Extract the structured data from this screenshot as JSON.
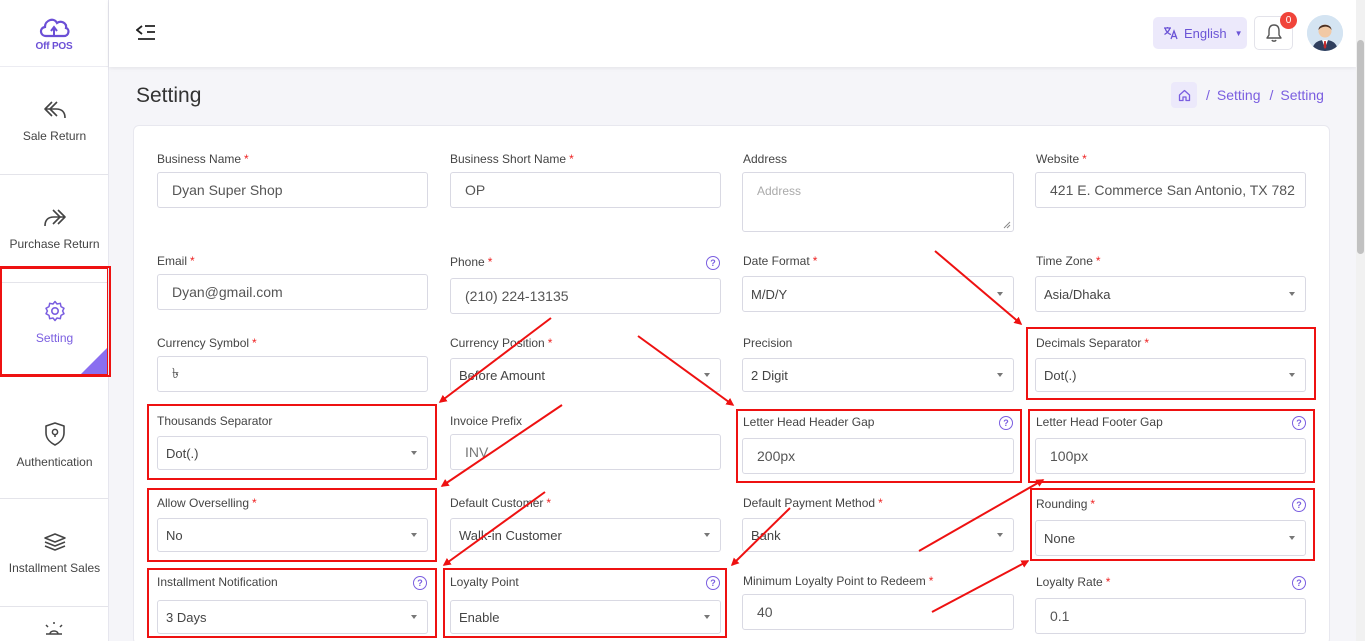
{
  "app": {
    "logo_text": "Off POS"
  },
  "sidebar": {
    "items": [
      {
        "label": "Sale Return",
        "icon": "sale-return-icon"
      },
      {
        "label": "Purchase Return",
        "icon": "purchase-return-icon"
      },
      {
        "label": "Setting",
        "icon": "gear-icon",
        "active": true
      },
      {
        "label": "Authentication",
        "icon": "shield-icon"
      },
      {
        "label": "Installment Sales",
        "icon": "stack-icon"
      }
    ]
  },
  "header": {
    "language": "English",
    "notification_count": "0"
  },
  "page": {
    "title": "Setting",
    "breadcrumb": [
      "Setting",
      "Setting"
    ]
  },
  "form": {
    "business_name": {
      "label": "Business Name",
      "value": "Dyan Super Shop",
      "required": true
    },
    "business_short_name": {
      "label": "Business Short Name",
      "value": "OP",
      "required": true
    },
    "address": {
      "label": "Address",
      "placeholder": "Address"
    },
    "website": {
      "label": "Website",
      "value": "421 E. Commerce San Antonio, TX 782",
      "required": true
    },
    "email": {
      "label": "Email",
      "value": "Dyan@gmail.com",
      "required": true
    },
    "phone": {
      "label": "Phone",
      "value": "(210) 224-13135",
      "required": true
    },
    "date_format": {
      "label": "Date Format",
      "value": "M/D/Y",
      "required": true
    },
    "time_zone": {
      "label": "Time Zone",
      "value": "Asia/Dhaka",
      "required": true
    },
    "currency_symbol": {
      "label": "Currency Symbol",
      "value": "৳",
      "required": true
    },
    "currency_position": {
      "label": "Currency Position",
      "value": "Before Amount",
      "required": true
    },
    "precision": {
      "label": "Precision",
      "value": "2 Digit"
    },
    "decimals_separator": {
      "label": "Decimals Separator",
      "value": "Dot(.)",
      "required": true
    },
    "thousands_separator": {
      "label": "Thousands Separator",
      "value": "Dot(.)"
    },
    "invoice_prefix": {
      "label": "Invoice Prefix",
      "value": "INV"
    },
    "letter_head_header_gap": {
      "label": "Letter Head Header Gap",
      "value": "200px"
    },
    "letter_head_footer_gap": {
      "label": "Letter Head Footer Gap",
      "value": "100px"
    },
    "allow_overselling": {
      "label": "Allow Overselling",
      "value": "No",
      "required": true
    },
    "default_customer": {
      "label": "Default Customer",
      "value": "Walk-in Customer",
      "required": true
    },
    "default_payment_method": {
      "label": "Default Payment Method",
      "value": "Bank",
      "required": true
    },
    "rounding": {
      "label": "Rounding",
      "value": "None",
      "required": true
    },
    "installment_notification": {
      "label": "Installment Notification",
      "value": "3 Days"
    },
    "loyalty_point": {
      "label": "Loyalty Point",
      "value": "Enable"
    },
    "min_loyalty_point": {
      "label": "Minimum Loyalty Point to Redeem",
      "value": "40",
      "required": true
    },
    "loyalty_rate": {
      "label": "Loyalty Rate",
      "value": "0.1",
      "required": true
    }
  },
  "colors": {
    "accent": "#7a5ee0",
    "highlight": "#e11111",
    "required": "#e22222",
    "badge": "#f0443a"
  }
}
